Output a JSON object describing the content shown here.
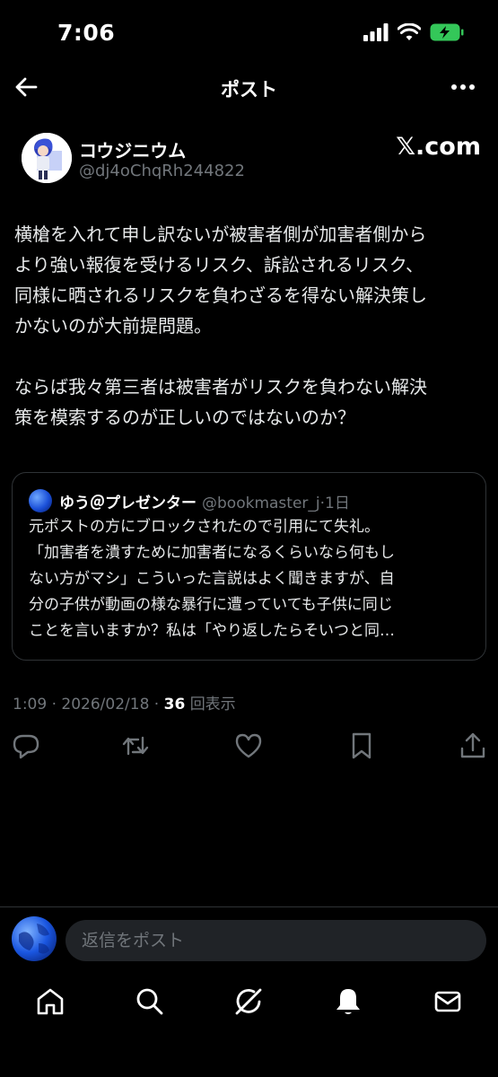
{
  "status_bar": {
    "time": "7:06"
  },
  "header": {
    "title": "ポスト"
  },
  "author": {
    "name": "コウジニウム",
    "handle": "@dj4oChqRh244822",
    "source": "𝕏.com"
  },
  "post": {
    "paragraph1": [
      "横槍を入れて申し訳ないが被害者側が加害者側から",
      "より強い報復を受けるリスク、訴訟されるリスク、",
      "同様に晒されるリスクを負わざるを得ない解決策し",
      "かないのが大前提問題。"
    ],
    "paragraph2": [
      "ならば我々第三者は被害者がリスクを負わない解決",
      "策を模索するのが正しいのではないのか？"
    ]
  },
  "quote": {
    "name": "ゆう＠プレゼンター",
    "handle": "@bookmaster_j·1日",
    "lines": [
      "元ポストの方にブロックされたので引用にて失礼。",
      "「加害者を潰すために加害者になるくらいなら何もし",
      "ない方がマシ」こういった言説はよく聞きますが、自",
      "分の子供が動画の様な暴行に遭っていても子供に同じ",
      "ことを言いますか？私は「やり返したらそいつと同…"
    ]
  },
  "meta": {
    "time": "1:09",
    "date": "2026/02/18",
    "views_count": "36",
    "views_label": "回表示"
  },
  "actions": {
    "icons": [
      "reply-icon",
      "repost-icon",
      "like-icon",
      "bookmark-icon",
      "share-icon"
    ]
  },
  "reply": {
    "placeholder": "返信をポスト"
  },
  "tabbar": {
    "icons": [
      "home-icon",
      "search-icon",
      "grok-icon",
      "notifications-icon",
      "messages-icon"
    ]
  },
  "colors": {
    "background": "#000000",
    "text": "#e7e9ea",
    "secondary_text": "#71767b",
    "border": "#2f3336",
    "battery": "#34c759"
  }
}
